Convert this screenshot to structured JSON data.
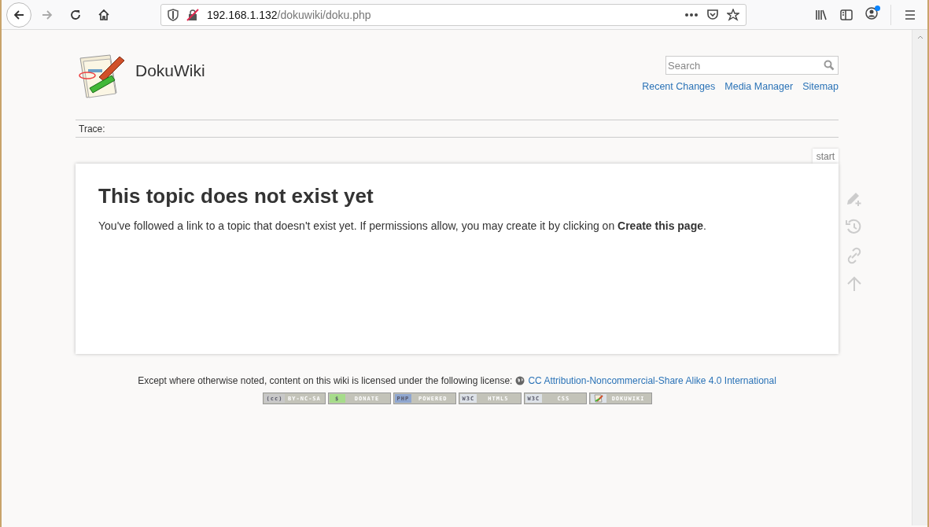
{
  "browser": {
    "url_host": "192.168.1.132",
    "url_path": "/dokuwiki/doku.php",
    "forward_disabled": true,
    "account_notification": true
  },
  "header": {
    "site_title": "DokuWiki",
    "search": {
      "placeholder": "Search"
    },
    "links": [
      "Recent Changes",
      "Media Manager",
      "Sitemap"
    ]
  },
  "trace": {
    "label": "Trace:"
  },
  "page": {
    "id_tab": "start",
    "heading": "This topic does not exist yet",
    "text": "You've followed a link to a topic that doesn't exist yet. If permissions allow, you may create it by clicking on **Create this page**."
  },
  "page_tools": [
    {
      "kind": "create"
    },
    {
      "kind": "revisions"
    },
    {
      "kind": "backlinks"
    },
    {
      "kind": "top"
    }
  ],
  "footer": {
    "license_text": "Except where otherwise noted, content on this wiki is licensed under the following license:",
    "license_link": "CC Attribution-Noncommercial-Share Alike 4.0 International",
    "badges": [
      {
        "left": "(cc)",
        "right": "BY-NC-SA",
        "color": "#c8c8c8"
      },
      {
        "left": "$",
        "right": "DONATE",
        "color": "#a6dc8a"
      },
      {
        "left": "PHP",
        "right": "POWERED",
        "color": "#8fa6cf"
      },
      {
        "left": "W3C",
        "right": "HTML5",
        "color": "#dde2e8"
      },
      {
        "left": "W3C",
        "right": "CSS",
        "color": "#dde2e8"
      },
      {
        "kind": "icon",
        "right": "DOKUWIKI",
        "color": "#dde2e8"
      }
    ]
  }
}
